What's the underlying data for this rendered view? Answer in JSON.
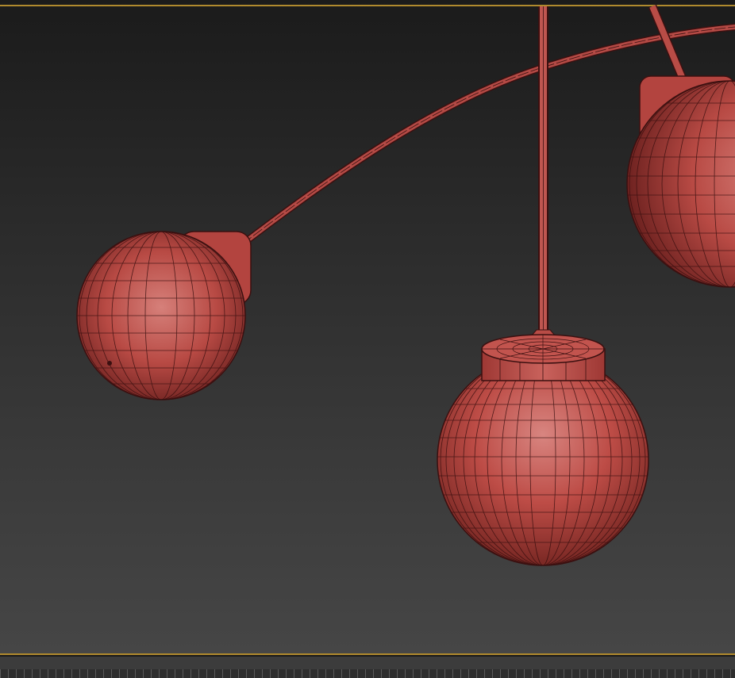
{
  "viewport": {
    "background_top": "#1b1b1b",
    "background_bottom": "#464646",
    "active_border_color": "#b08a2e"
  },
  "scene": {
    "object_color": "#c4504c",
    "wire_color": "#3a1010",
    "objects": [
      "left-pendant-globe",
      "center-pendant-globe",
      "right-pendant-globe",
      "curved-arm",
      "vertical-rod",
      "diagonal-rod"
    ]
  },
  "timeline": {
    "background": "#3c3c3c"
  }
}
